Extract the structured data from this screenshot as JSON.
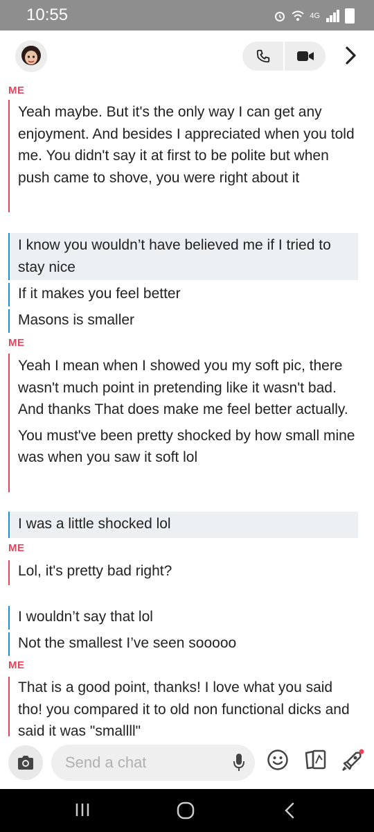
{
  "status_bar": {
    "time": "10:55",
    "network": "4G"
  },
  "header": {
    "avatar_icon": "bitmoji-avatar-icon",
    "call_icon": "phone-icon",
    "video_icon": "video-camera-icon",
    "more_icon": "chevron-right-icon"
  },
  "messages": [
    {
      "sender": "ME",
      "text": "Yeah maybe. But it's the only way I can get any enjoyment. And besides I appreciated when you told me. You didn't say it at first to be polite but when push came to shove, you were right about it"
    },
    {
      "sender": "",
      "text": "I know you wouldn’t have believed me if I tried to stay nice"
    },
    {
      "sender": "",
      "text": "If it makes you feel better"
    },
    {
      "sender": "",
      "text": "Masons is smaller"
    },
    {
      "sender": "ME",
      "text": "Yeah I mean when I showed you my soft pic, there wasn't much point in pretending like it wasn't bad. And thanks That does make me feel better actually."
    },
    {
      "sender": "",
      "text": "You must've been pretty shocked by how small mine was when you saw it soft lol"
    },
    {
      "sender": "",
      "text": "I was a little shocked lol"
    },
    {
      "sender": "ME",
      "text": "Lol, it's pretty bad right?"
    },
    {
      "sender": "",
      "text": "I wouldn’t say that lol"
    },
    {
      "sender": "",
      "text": "Not the smallest I’ve seen sooooo"
    },
    {
      "sender": "ME",
      "text": "That is a good point, thanks! I love what you said tho! you compared it to old non functional dicks and said it was \"smallll\""
    }
  ],
  "input": {
    "placeholder": "Send a chat",
    "camera_icon": "camera-icon",
    "mic_icon": "microphone-icon",
    "emoji_icon": "smiley-icon",
    "cards_icon": "cards-icon",
    "rocket_icon": "rocket-icon"
  },
  "nav": {
    "recents_icon": "recents-icon",
    "home_icon": "home-icon",
    "back_icon": "back-icon"
  },
  "colors": {
    "me": "#e8445b",
    "them": "#1a8fd6",
    "highlight": "#edf0f2"
  }
}
